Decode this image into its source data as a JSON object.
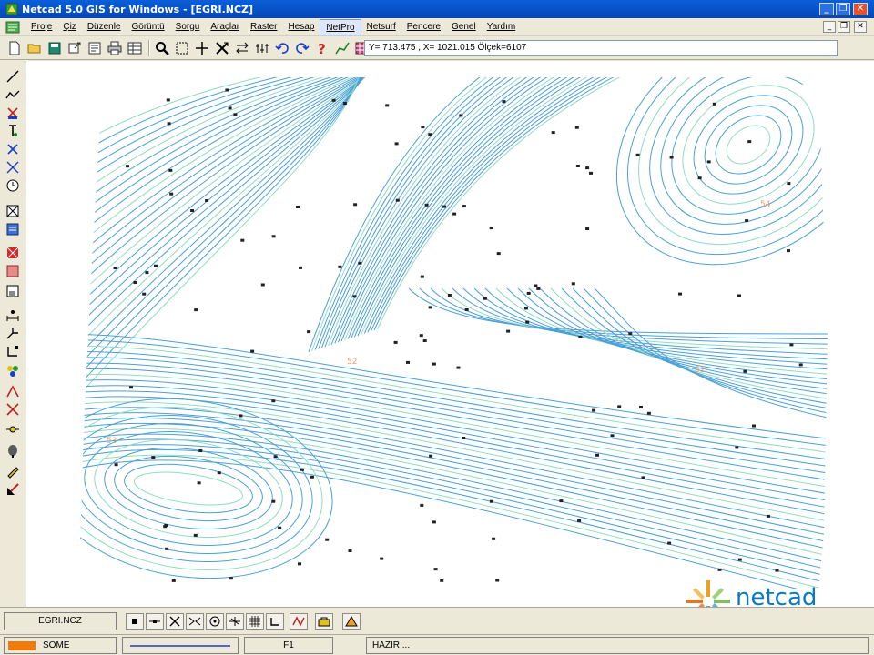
{
  "window": {
    "title": "Netcad 5.0 GIS for Windows - [EGRI.NCZ]",
    "minimize_glyph": "_",
    "restore_glyph": "❐",
    "close_glyph": "✕"
  },
  "menu": {
    "items": [
      "Proje",
      "Çiz",
      "Düzenle",
      "Görüntü",
      "Sorgu",
      "Araçlar",
      "Raster",
      "Hesap",
      "NetPro",
      "Netsurf",
      "Pencere",
      "Genel",
      "Yardım"
    ],
    "active_index": 8
  },
  "toolbar": {
    "coordinate_readout": "Y= 713.475 , X= 1021.015 Ölçek=6107"
  },
  "map": {
    "labels": [
      {
        "text": "54"
      },
      {
        "text": "52"
      },
      {
        "text": "51"
      },
      {
        "text": "53"
      }
    ],
    "contour_color": "#4a9fd8",
    "index_contour_color": "#90dcc0",
    "point_color": "#222222",
    "label_color": "#e8a070"
  },
  "bottom": {
    "drawing_tab": "EGRI.NCZ"
  },
  "status": {
    "layer_name": "SOME",
    "function_key": "F1",
    "message": "HAZIR ...",
    "layer_color": "#f07a0a"
  },
  "brand": {
    "logo_text": "netcad",
    "logo_color": "#0a78c9"
  }
}
